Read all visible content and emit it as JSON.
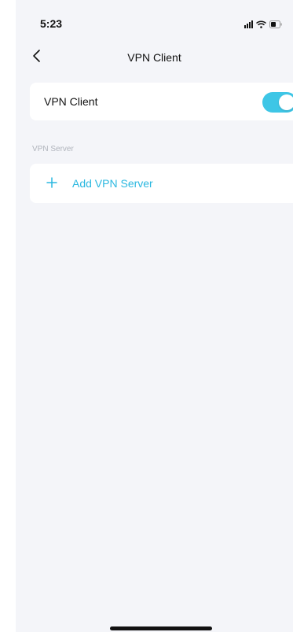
{
  "status_bar": {
    "time": "5:23",
    "icons": [
      "signal-icon",
      "wifi-icon",
      "battery-icon"
    ]
  },
  "nav": {
    "title": "VPN Client",
    "back_icon": "chevron-left-icon"
  },
  "vpn_client": {
    "label": "VPN Client",
    "enabled": true,
    "toggle_color": "#3ec6e6"
  },
  "vpn_server": {
    "section_label": "VPN Server",
    "add_label": "Add VPN Server",
    "add_icon": "plus-icon",
    "accent_color": "#2bb8e0"
  },
  "colors": {
    "background": "#f4f5f9",
    "card": "#ffffff",
    "text": "#111111",
    "muted": "#b0b4bc"
  }
}
